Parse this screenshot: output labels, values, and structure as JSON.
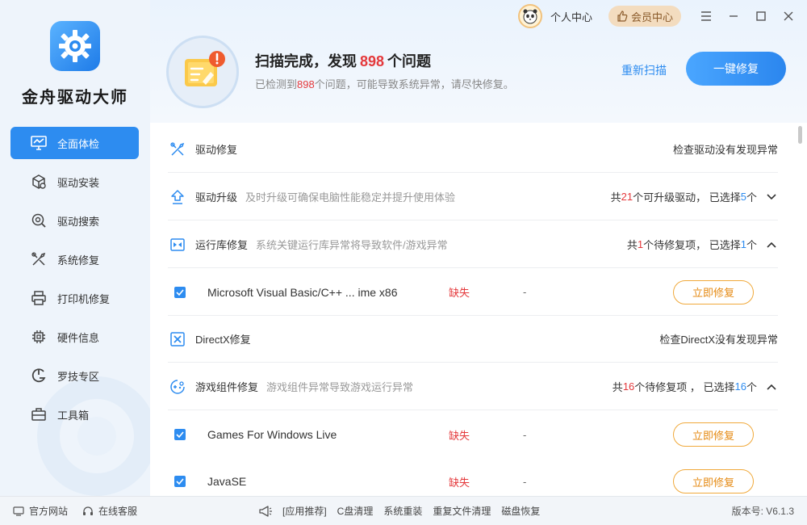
{
  "app": {
    "title": "金舟驱动大师"
  },
  "topbar": {
    "user_center": "个人中心",
    "vip_center": "会员中心"
  },
  "sidebar": {
    "items": [
      {
        "label": "全面体检",
        "icon": "monitor-icon",
        "active": true
      },
      {
        "label": "驱动安装",
        "icon": "box-settings-icon"
      },
      {
        "label": "驱动搜索",
        "icon": "search-gear-icon"
      },
      {
        "label": "系统修复",
        "icon": "tools-icon"
      },
      {
        "label": "打印机修复",
        "icon": "printer-icon"
      },
      {
        "label": "硬件信息",
        "icon": "chip-icon"
      },
      {
        "label": "罗技专区",
        "icon": "logitech-icon"
      },
      {
        "label": "工具箱",
        "icon": "toolbox-icon"
      }
    ]
  },
  "scan": {
    "title_prefix": "扫描完成，发现",
    "count": "898",
    "title_suffix": "个问题",
    "sub_prefix": "已检测到",
    "sub_count": "898",
    "sub_suffix": "个问题，可能导致系统异常，请尽快修复。",
    "rescan": "重新扫描",
    "fix_all": "一键修复"
  },
  "sections": {
    "driver_repair": {
      "name": "驱动修复",
      "status": "检查驱动没有发现异常"
    },
    "driver_upgrade": {
      "name": "驱动升级",
      "desc": "及时升级可确保电脑性能稳定并提升使用体验",
      "r1": "共",
      "total": "21",
      "r2": "个可升级驱动， 已选择",
      "selected": "5",
      "r3": "个"
    },
    "runtime": {
      "name": "运行库修复",
      "desc": "系统关键运行库异常将导致软件/游戏异常",
      "r1": "共",
      "total": "1",
      "r2": "个待修复项， 已选择",
      "selected": "1",
      "r3": "个",
      "items": [
        {
          "name": "Microsoft Visual Basic/C++ ... ime x86",
          "status": "缺失",
          "version": "-",
          "action": "立即修复"
        }
      ]
    },
    "directx": {
      "name": "DirectX修复",
      "status": "检查DirectX没有发现异常"
    },
    "game": {
      "name": "游戏组件修复",
      "desc": "游戏组件异常导致游戏运行异常",
      "r1": "共",
      "total": "16",
      "r2": "个待修复项 ， 已选择",
      "selected": "16",
      "r3": "个",
      "items": [
        {
          "name": "Games For Windows Live",
          "status": "缺失",
          "version": "-",
          "action": "立即修复"
        },
        {
          "name": "JavaSE",
          "status": "缺失",
          "version": "-",
          "action": "立即修复"
        }
      ]
    }
  },
  "footer": {
    "website": "官方网站",
    "support": "在线客服",
    "recommend": "[应用推荐]",
    "links": [
      "C盘清理",
      "系统重装",
      "重复文件清理",
      "磁盘恢复"
    ],
    "version": "版本号:  V6.1.3"
  },
  "colors": {
    "accent": "#2d8cf0",
    "danger": "#e4393c",
    "warning": "#f0a93b"
  }
}
